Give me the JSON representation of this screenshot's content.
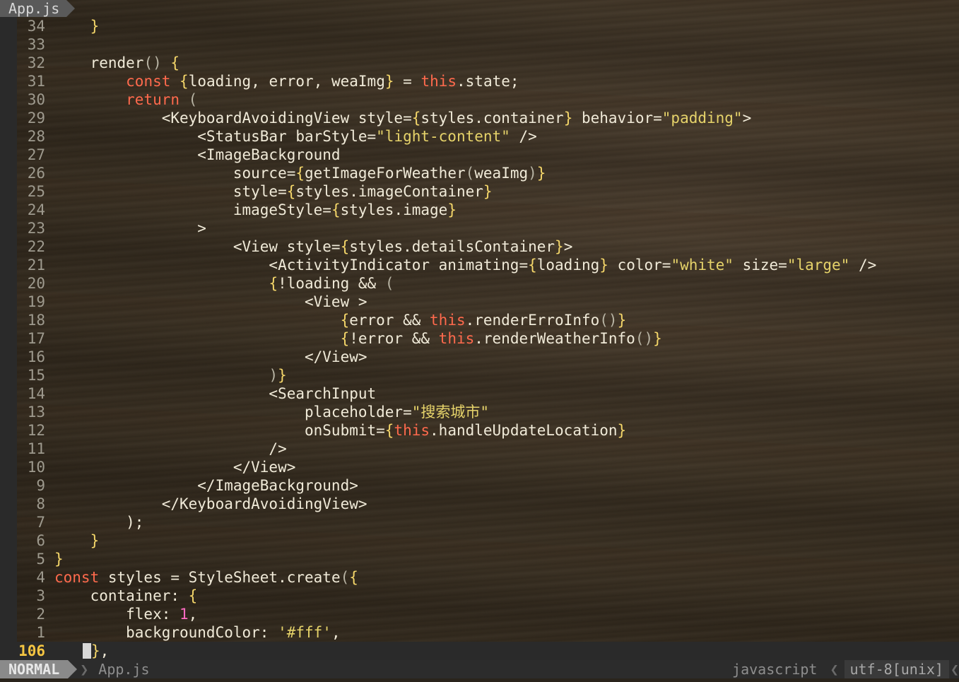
{
  "tab": {
    "label": "App.js"
  },
  "lines": [
    {
      "num": "34",
      "segments": [
        {
          "t": "    "
        },
        {
          "t": "}",
          "c": "brace"
        }
      ]
    },
    {
      "num": "33",
      "segments": []
    },
    {
      "num": "32",
      "segments": [
        {
          "t": "    render"
        },
        {
          "t": "()",
          "c": "paren"
        },
        {
          "t": " "
        },
        {
          "t": "{",
          "c": "brace"
        }
      ]
    },
    {
      "num": "31",
      "segments": [
        {
          "t": "        "
        },
        {
          "t": "const",
          "c": "kw"
        },
        {
          "t": " "
        },
        {
          "t": "{",
          "c": "brace"
        },
        {
          "t": "loading, error, weaImg"
        },
        {
          "t": "}",
          "c": "brace"
        },
        {
          "t": " = "
        },
        {
          "t": "this",
          "c": "kw"
        },
        {
          "t": ".state;"
        }
      ]
    },
    {
      "num": "30",
      "segments": [
        {
          "t": "        "
        },
        {
          "t": "return",
          "c": "kw"
        },
        {
          "t": " "
        },
        {
          "t": "(",
          "c": "paren"
        }
      ]
    },
    {
      "num": "29",
      "segments": [
        {
          "t": "            <KeyboardAvoidingView style="
        },
        {
          "t": "{",
          "c": "brace"
        },
        {
          "t": "styles.container"
        },
        {
          "t": "}",
          "c": "brace"
        },
        {
          "t": " behavior="
        },
        {
          "t": "\"padding\"",
          "c": "str"
        },
        {
          "t": ">"
        }
      ]
    },
    {
      "num": "28",
      "segments": [
        {
          "t": "                <StatusBar barStyle="
        },
        {
          "t": "\"light-content\"",
          "c": "str"
        },
        {
          "t": " />"
        }
      ]
    },
    {
      "num": "27",
      "segments": [
        {
          "t": "                <ImageBackground"
        }
      ]
    },
    {
      "num": "26",
      "segments": [
        {
          "t": "                    source="
        },
        {
          "t": "{",
          "c": "brace"
        },
        {
          "t": "getImageForWeather"
        },
        {
          "t": "(",
          "c": "paren"
        },
        {
          "t": "weaImg"
        },
        {
          "t": ")",
          "c": "paren"
        },
        {
          "t": "}",
          "c": "brace"
        }
      ]
    },
    {
      "num": "25",
      "segments": [
        {
          "t": "                    style="
        },
        {
          "t": "{",
          "c": "brace"
        },
        {
          "t": "styles.imageContainer"
        },
        {
          "t": "}",
          "c": "brace"
        }
      ]
    },
    {
      "num": "24",
      "segments": [
        {
          "t": "                    imageStyle="
        },
        {
          "t": "{",
          "c": "brace"
        },
        {
          "t": "styles.image"
        },
        {
          "t": "}",
          "c": "brace"
        }
      ]
    },
    {
      "num": "23",
      "segments": [
        {
          "t": "                >"
        }
      ]
    },
    {
      "num": "22",
      "segments": [
        {
          "t": "                    <View style="
        },
        {
          "t": "{",
          "c": "brace"
        },
        {
          "t": "styles.detailsContainer"
        },
        {
          "t": "}",
          "c": "brace"
        },
        {
          "t": ">"
        }
      ]
    },
    {
      "num": "21",
      "segments": [
        {
          "t": "                        <ActivityIndicator animating="
        },
        {
          "t": "{",
          "c": "brace"
        },
        {
          "t": "loading"
        },
        {
          "t": "}",
          "c": "brace"
        },
        {
          "t": " color="
        },
        {
          "t": "\"white\"",
          "c": "str"
        },
        {
          "t": " size="
        },
        {
          "t": "\"large\"",
          "c": "str"
        },
        {
          "t": " />"
        }
      ]
    },
    {
      "num": "20",
      "segments": [
        {
          "t": "                        "
        },
        {
          "t": "{",
          "c": "brace"
        },
        {
          "t": "!loading && "
        },
        {
          "t": "(",
          "c": "paren"
        }
      ]
    },
    {
      "num": "19",
      "segments": [
        {
          "t": "                            <View >"
        }
      ]
    },
    {
      "num": "18",
      "segments": [
        {
          "t": "                                "
        },
        {
          "t": "{",
          "c": "brace"
        },
        {
          "t": "error && "
        },
        {
          "t": "this",
          "c": "kw"
        },
        {
          "t": ".renderErroInfo"
        },
        {
          "t": "()",
          "c": "paren"
        },
        {
          "t": "}",
          "c": "brace"
        }
      ]
    },
    {
      "num": "17",
      "segments": [
        {
          "t": "                                "
        },
        {
          "t": "{",
          "c": "brace"
        },
        {
          "t": "!error && "
        },
        {
          "t": "this",
          "c": "kw"
        },
        {
          "t": ".renderWeatherInfo"
        },
        {
          "t": "()",
          "c": "paren"
        },
        {
          "t": "}",
          "c": "brace"
        }
      ]
    },
    {
      "num": "16",
      "segments": [
        {
          "t": "                            </View>"
        }
      ]
    },
    {
      "num": "15",
      "segments": [
        {
          "t": "                        "
        },
        {
          "t": ")",
          "c": "paren"
        },
        {
          "t": "}",
          "c": "brace"
        }
      ]
    },
    {
      "num": "14",
      "segments": [
        {
          "t": "                        <SearchInput"
        }
      ]
    },
    {
      "num": "13",
      "segments": [
        {
          "t": "                            placeholder="
        },
        {
          "t": "\"搜索城市\"",
          "c": "str"
        }
      ]
    },
    {
      "num": "12",
      "segments": [
        {
          "t": "                            onSubmit="
        },
        {
          "t": "{",
          "c": "brace"
        },
        {
          "t": "this",
          "c": "kw"
        },
        {
          "t": ".handleUpdateLocation"
        },
        {
          "t": "}",
          "c": "brace"
        }
      ]
    },
    {
      "num": "11",
      "segments": [
        {
          "t": "                        />"
        }
      ]
    },
    {
      "num": "10",
      "segments": [
        {
          "t": "                    </View>"
        }
      ]
    },
    {
      "num": "9",
      "segments": [
        {
          "t": "                </ImageBackground>"
        }
      ]
    },
    {
      "num": "8",
      "segments": [
        {
          "t": "            </KeyboardAvoidingView>"
        }
      ]
    },
    {
      "num": "7",
      "segments": [
        {
          "t": "        );"
        }
      ]
    },
    {
      "num": "6",
      "segments": [
        {
          "t": "    "
        },
        {
          "t": "}",
          "c": "brace"
        }
      ]
    },
    {
      "num": "5",
      "segments": [
        {
          "t": "}",
          "c": "brace"
        }
      ]
    },
    {
      "num": "4",
      "segments": [
        {
          "t": "const",
          "c": "kw"
        },
        {
          "t": " styles = StyleSheet.create"
        },
        {
          "t": "(",
          "c": "paren"
        },
        {
          "t": "{",
          "c": "brace"
        }
      ]
    },
    {
      "num": "3",
      "segments": [
        {
          "t": "    container: "
        },
        {
          "t": "{",
          "c": "brace"
        }
      ]
    },
    {
      "num": "2",
      "segments": [
        {
          "t": "        flex: "
        },
        {
          "t": "1",
          "c": "num"
        },
        {
          "t": ","
        }
      ]
    },
    {
      "num": "1",
      "segments": [
        {
          "t": "        backgroundColor: "
        },
        {
          "t": "'#fff'",
          "c": "str"
        },
        {
          "t": ","
        }
      ]
    }
  ],
  "current_line": {
    "num": "106",
    "brace": "}",
    "rest": ","
  },
  "status": {
    "mode": "NORMAL",
    "file": "App.js",
    "filetype": "javascript",
    "encoding": "utf-8[unix]"
  },
  "colors": {
    "keyword": "#ff6a4d",
    "string": "#e6d36a",
    "brace": "#f5d76a",
    "number": "#ff6ac1",
    "line_number": "#9e9a8e",
    "current_line_number": "#f5c542"
  }
}
